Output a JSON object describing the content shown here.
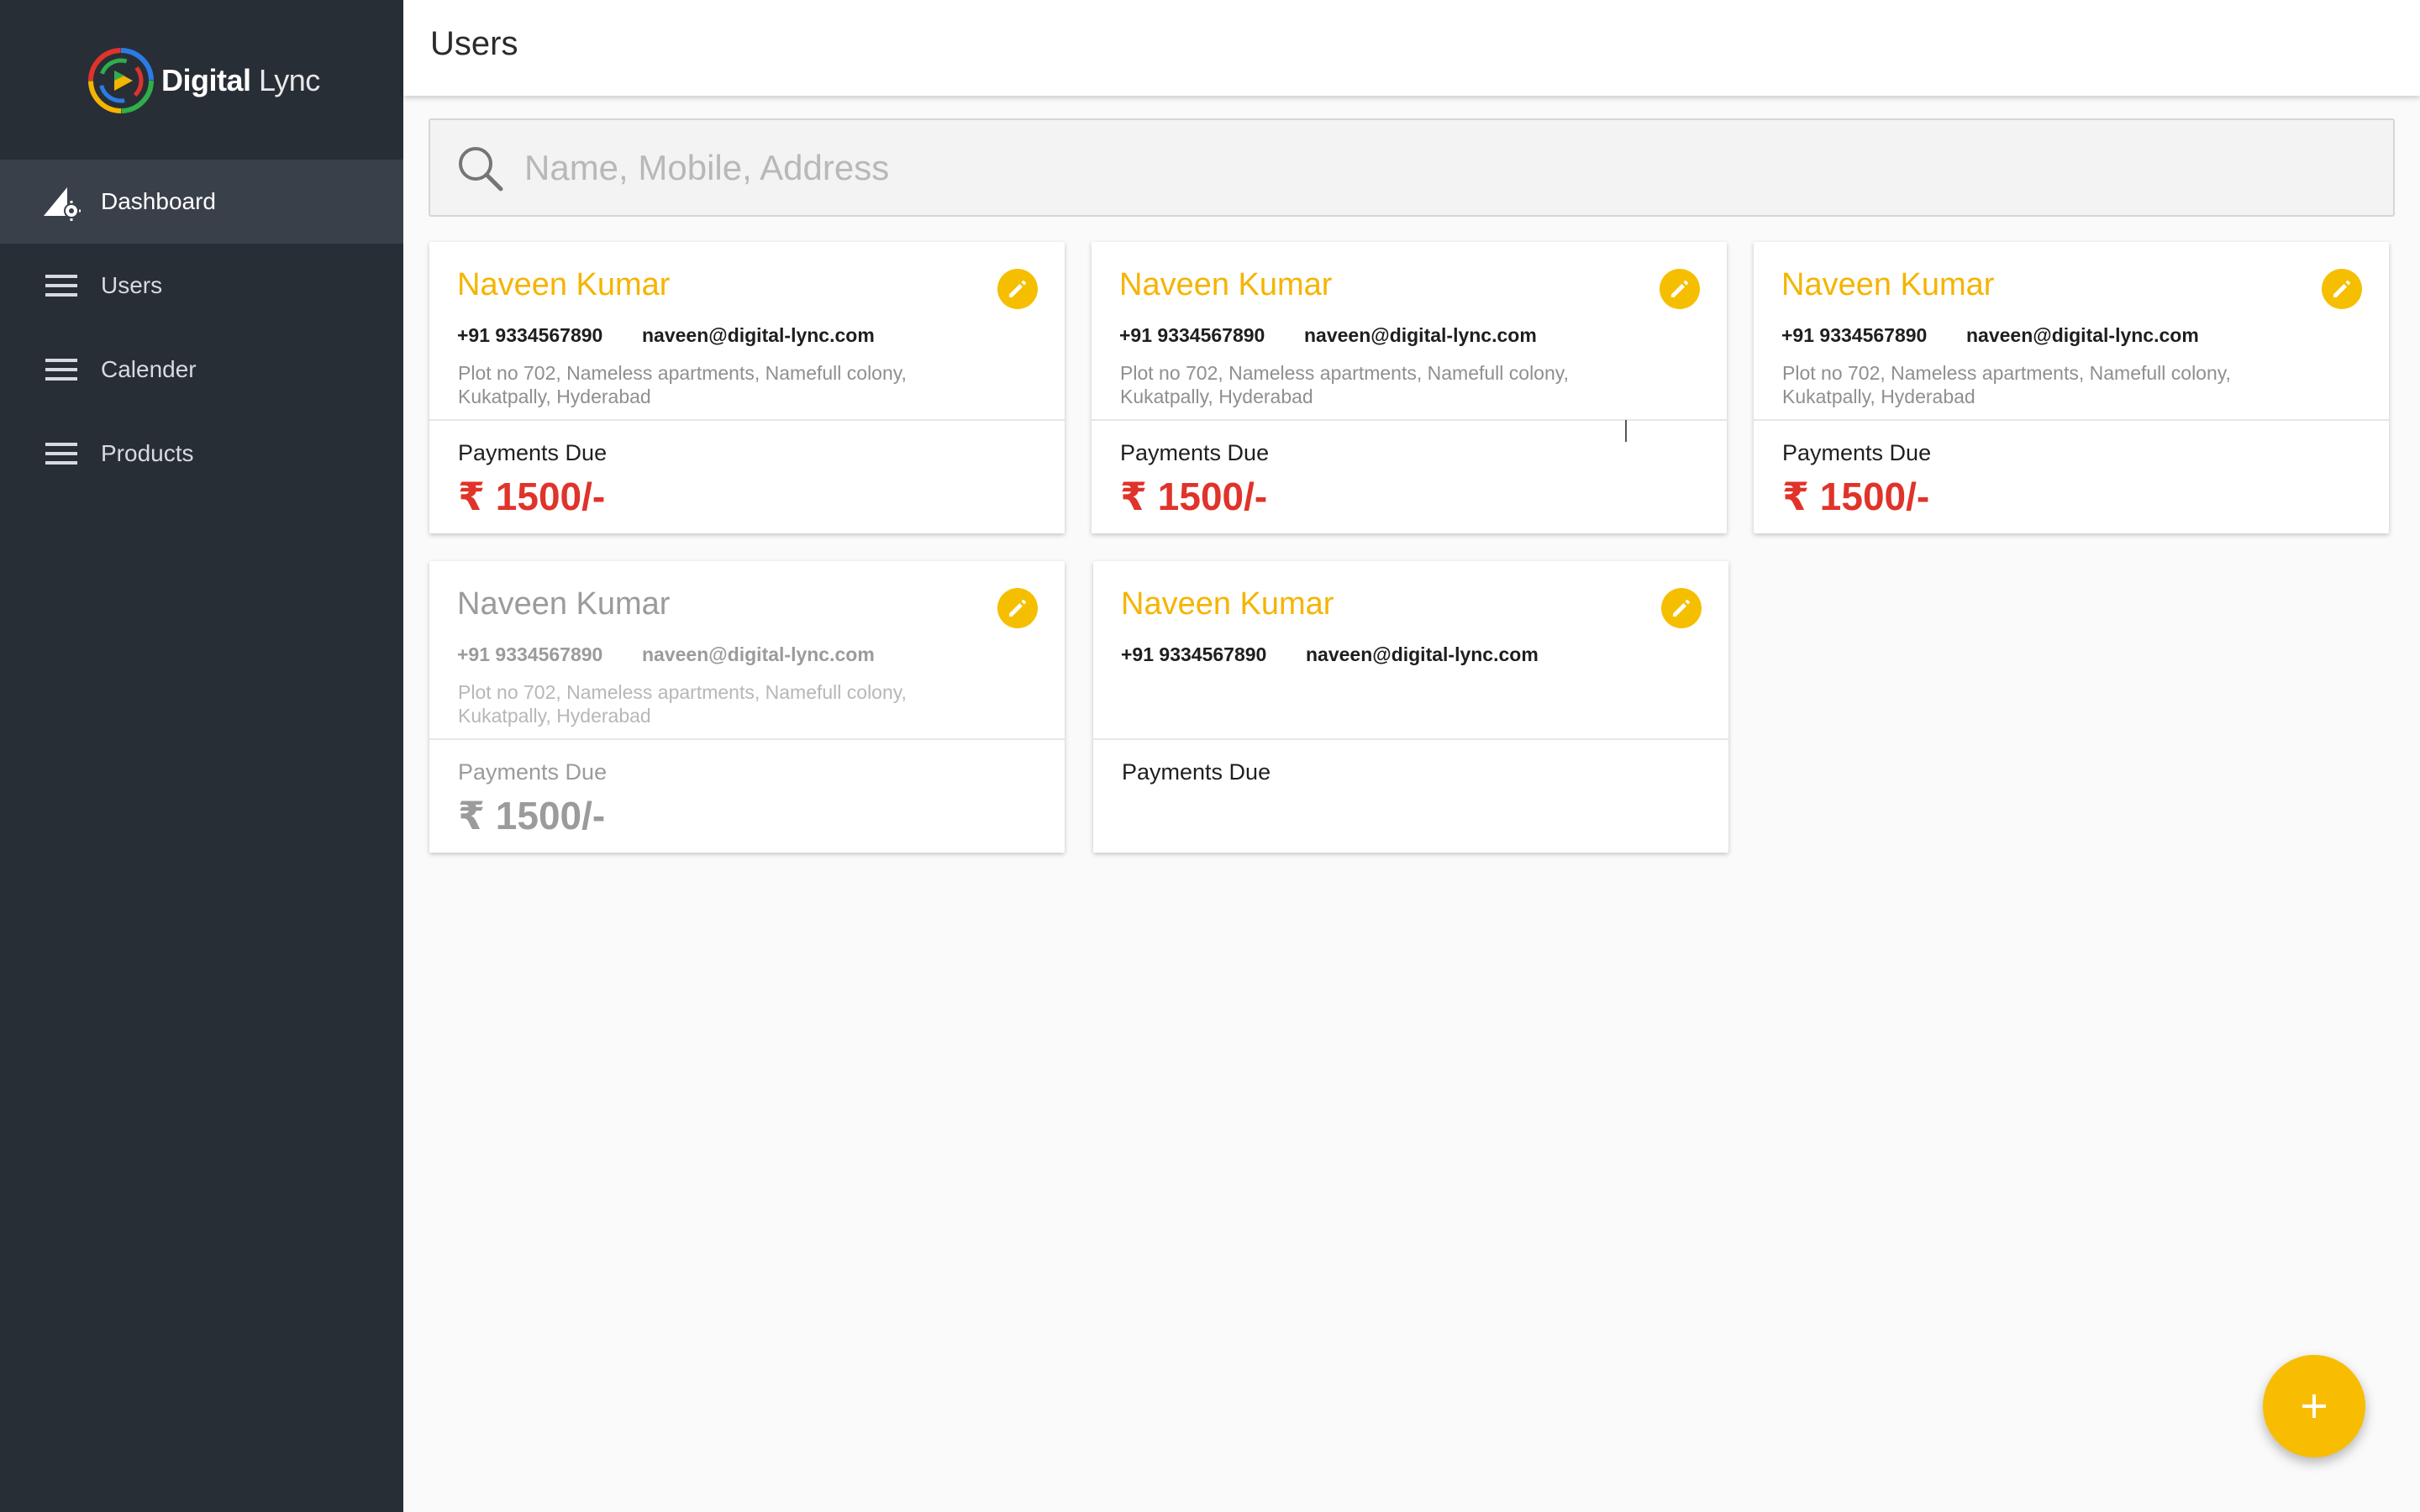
{
  "brand": {
    "name_bold": "Digital",
    "name_light": "Lync"
  },
  "sidebar": {
    "items": [
      {
        "label": "Dashboard",
        "icon": "dashboard-gear-icon",
        "active": true
      },
      {
        "label": "Users",
        "icon": "menu-icon",
        "active": false
      },
      {
        "label": "Calender",
        "icon": "menu-icon",
        "active": false
      },
      {
        "label": "Products",
        "icon": "menu-icon",
        "active": false
      }
    ]
  },
  "header": {
    "title": "Users"
  },
  "search": {
    "placeholder": "Name, Mobile, Address",
    "value": ""
  },
  "cards": [
    {
      "name": "Naveen Kumar",
      "phone": "+91 9334567890",
      "email": "naveen@digital-lync.com",
      "address": "Plot no 702, Nameless apartments, Namefull colony, Kukatpally, Hyderabad",
      "due_label": "Payments Due",
      "due_amount": "₹ 1500/-",
      "state": "active"
    },
    {
      "name": "Naveen Kumar",
      "phone": "+91 9334567890",
      "email": "naveen@digital-lync.com",
      "address": "Plot no 702, Nameless apartments, Namefull colony, Kukatpally, Hyderabad",
      "due_label": "Payments Due",
      "due_amount": "₹ 1500/-",
      "state": "active"
    },
    {
      "name": "Naveen Kumar",
      "phone": "+91 9334567890",
      "email": "naveen@digital-lync.com",
      "address": "Plot no 702, Nameless apartments, Namefull colony, Kukatpally, Hyderabad",
      "due_label": "Payments Due",
      "due_amount": "₹ 1500/-",
      "state": "active"
    },
    {
      "name": "Naveen Kumar",
      "phone": "+91 9334567890",
      "email": "naveen@digital-lync.com",
      "address": "Plot no 702, Nameless apartments, Namefull colony, Kukatpally, Hyderabad",
      "due_label": "Payments Due",
      "due_amount": "₹ 1500/-",
      "state": "disabled"
    },
    {
      "name": "Naveen Kumar",
      "phone": "+91 9334567890",
      "email": "naveen@digital-lync.com",
      "address": "",
      "due_label": "Payments Due",
      "due_amount": "",
      "state": "active"
    }
  ],
  "fab": {
    "label": "+",
    "icon": "plus-icon"
  },
  "colors": {
    "sidebar": "#282e36",
    "accent": "#f5bf00",
    "due": "#e0332a"
  }
}
